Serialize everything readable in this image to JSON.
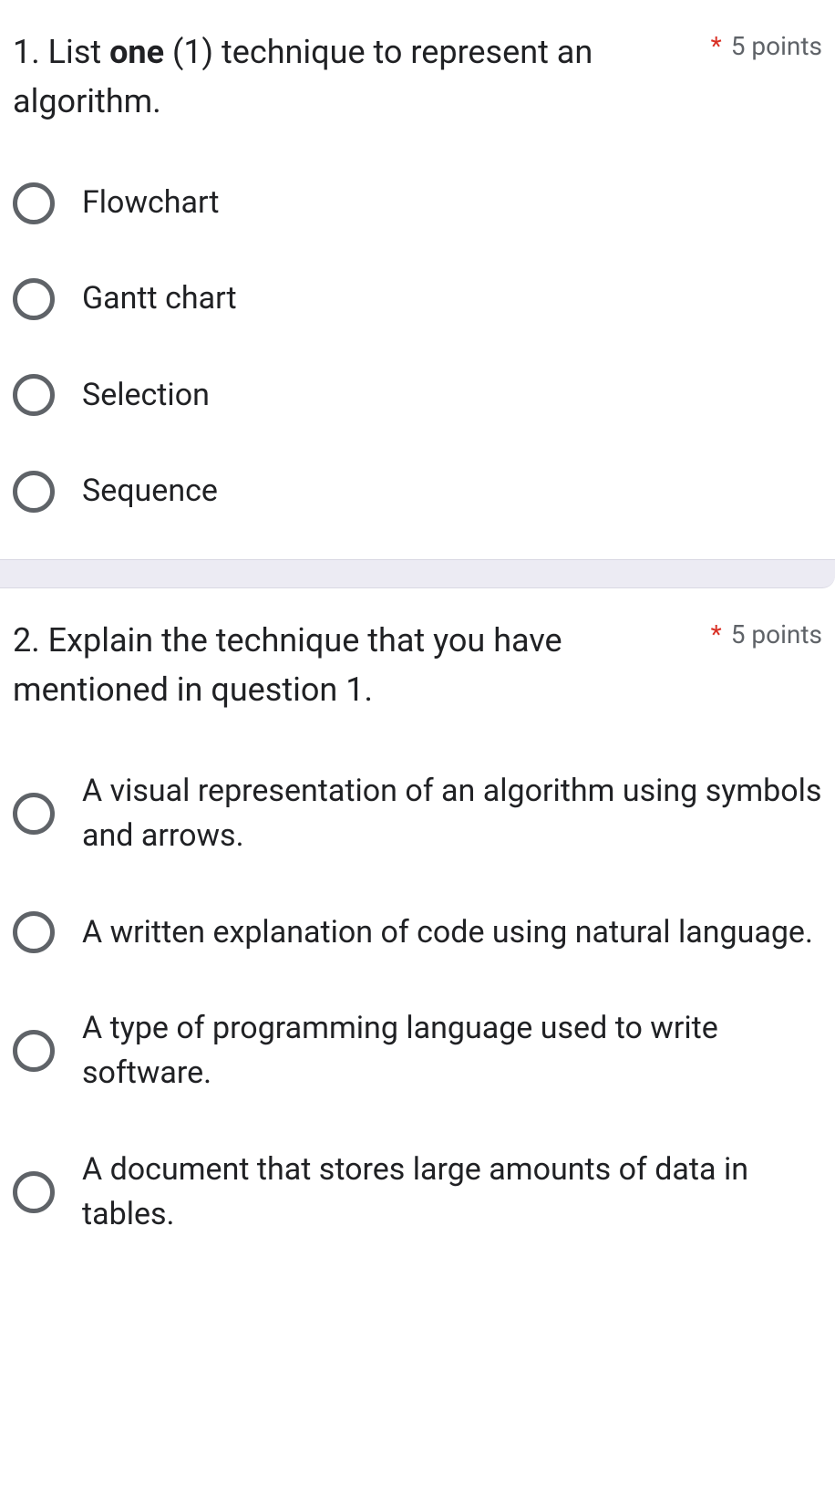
{
  "questions": [
    {
      "number": "1.",
      "title_pre": "List ",
      "title_bold": "one",
      "title_post": " (1) technique to represent an algorithm.",
      "required_mark": "*",
      "points": "5 points",
      "options": [
        "Flowchart",
        "Gantt chart",
        "Selection",
        "Sequence"
      ]
    },
    {
      "number": "2.",
      "title_pre": "Explain the technique that you have mentioned in question 1.",
      "title_bold": "",
      "title_post": "",
      "required_mark": "*",
      "points": "5 points",
      "options": [
        "A visual representation of an algorithm using symbols and arrows.",
        "A written explanation of code using natural language.",
        "A type of programming language used to write software.",
        "A document that stores large amounts of data in tables."
      ]
    }
  ]
}
